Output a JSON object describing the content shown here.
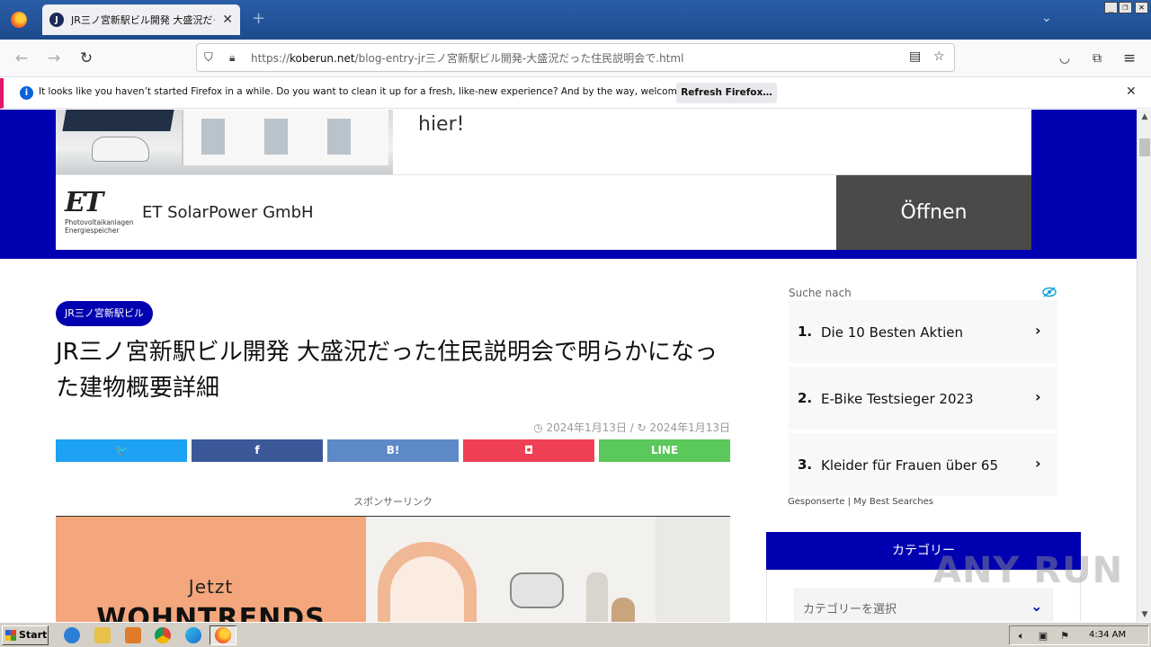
{
  "browser": {
    "tab_title": "JR三ノ宮新駅ビル開発 大盛況だった住民説明会で明らかになった建物概要詳細",
    "tab_favicon_letter": "J",
    "url_prefix": "https://",
    "url_domain": "koberun.net",
    "url_path": "/blog-entry-jr三ノ宮新駅ビル開発-大盛況だった住民説明会で.html",
    "notification_text": "It looks like you haven’t started Firefox in a while. Do you want to clean it up for a fresh, like-new experience? And by the way, welcome back!",
    "notification_button": "Refresh Firefox…"
  },
  "ad_top": {
    "headline": "hier!",
    "logo_mark": "ET",
    "logo_sub_1": "Photovoltaikanlagen",
    "logo_sub_2": "Energiespeicher",
    "company": "ET SolarPower GmbH",
    "open_button": "Öffnen"
  },
  "article": {
    "category_badge": "JR三ノ宮新駅ビル",
    "title": "JR三ノ宮新駅ビル開発 大盛況だった住民説明会で明らかになった建物概要詳細",
    "date_published": "2024年1月13日",
    "date_separator": "/",
    "date_updated": "2024年1月13日",
    "share_buttons": [
      {
        "label": "🐦",
        "color": "#1da1f2"
      },
      {
        "label": "f",
        "color": "#3b5998"
      },
      {
        "label": "B!",
        "color": "#5d8ac6"
      },
      {
        "label": "◘",
        "color": "#ef4056"
      },
      {
        "label": "LINE",
        "color": "#5ac85a"
      }
    ],
    "sponsor_label": "スポンサーリンク",
    "banner_line1": "Jetzt",
    "banner_line2": "WOHNTRENDS"
  },
  "sidebar": {
    "search_header": "Suche nach",
    "search_items": [
      {
        "num": "1.",
        "label": "Die 10 Besten Aktien"
      },
      {
        "num": "2.",
        "label": "E-Bike Testsieger 2023"
      },
      {
        "num": "3.",
        "label": "Kleider für Frauen über 65"
      }
    ],
    "sponsored_text": "Gesponserte | My Best Searches",
    "category_header": "カテゴリー",
    "category_select_placeholder": "カテゴリーを選択"
  },
  "watermark": "ANY RUN",
  "taskbar": {
    "start_label": "Start",
    "clock": "4:34 AM"
  }
}
